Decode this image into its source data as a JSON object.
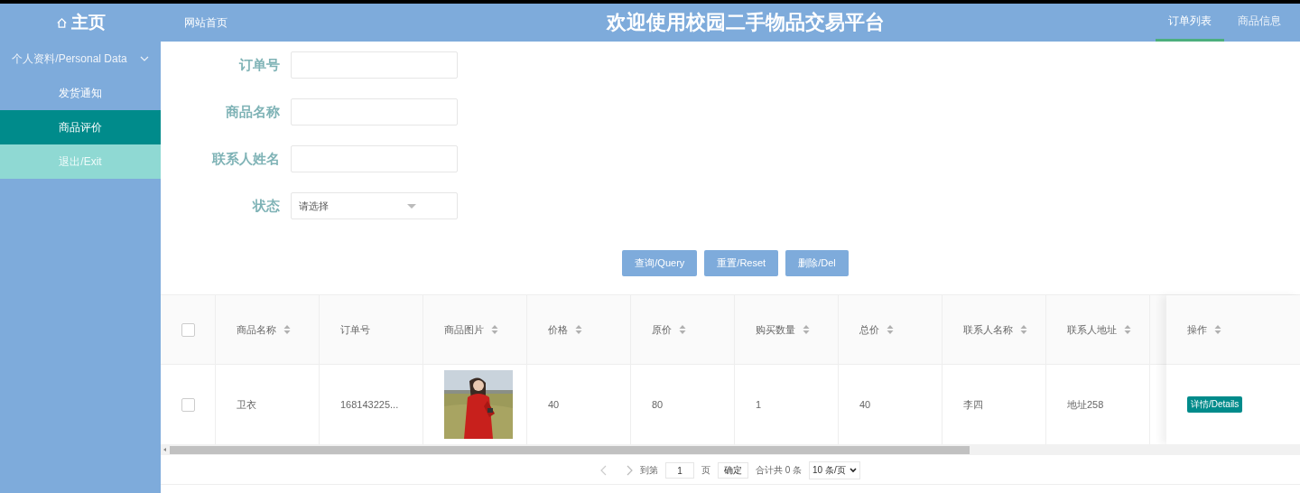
{
  "header": {
    "home": "主页",
    "site_link": "网站首页",
    "title": "欢迎使用校园二手物品交易平台",
    "nav": [
      {
        "label": "订单列表",
        "selected": true
      },
      {
        "label": "商品信息",
        "selected": false
      }
    ]
  },
  "sidebar": {
    "items": [
      {
        "label": "个人资料/Personal Data",
        "kind": "group",
        "expanded": true
      },
      {
        "label": "发货通知",
        "kind": "link",
        "selected": false
      },
      {
        "label": "商品评价",
        "kind": "link",
        "selected": true
      },
      {
        "label": "退出/Exit",
        "kind": "exit",
        "selected": false
      }
    ]
  },
  "search": {
    "fields": [
      {
        "label": "订单号",
        "kind": "text"
      },
      {
        "label": "商品名称",
        "kind": "text"
      },
      {
        "label": "联系人姓名",
        "kind": "text"
      },
      {
        "label": "状态",
        "kind": "select",
        "placeholder": "请选择"
      }
    ],
    "buttons": [
      "查询/Query",
      "重置/Reset",
      "删除/Del"
    ]
  },
  "table": {
    "select_all": {
      "checked": false
    },
    "columns": [
      {
        "label": "商品名称",
        "sortable": true
      },
      {
        "label": "订单号",
        "sortable": false
      },
      {
        "label": "商品图片",
        "sortable": true
      },
      {
        "label": "价格",
        "sortable": true
      },
      {
        "label": "原价",
        "sortable": true
      },
      {
        "label": "购买数量",
        "sortable": true
      },
      {
        "label": "总价",
        "sortable": true
      },
      {
        "label": "联系人名称",
        "sortable": true
      },
      {
        "label": "联系人地址",
        "sortable": true
      }
    ],
    "action_column": {
      "label": "操作",
      "sortable": true
    },
    "rows": [
      {
        "checked": false,
        "cells": [
          {
            "kind": "text",
            "text": "卫衣"
          },
          {
            "kind": "text",
            "text": "168143225..."
          },
          {
            "kind": "picture"
          },
          {
            "kind": "text",
            "text": "40"
          },
          {
            "kind": "text",
            "text": "80"
          },
          {
            "kind": "text",
            "text": "1"
          },
          {
            "kind": "text",
            "text": "40"
          },
          {
            "kind": "text",
            "text": "李四"
          },
          {
            "kind": "text",
            "text": "地址258"
          }
        ],
        "action": "详情/Details"
      }
    ]
  },
  "pagination": {
    "goto_label": "到第",
    "page": "1",
    "page_unit": "页",
    "confirm": "确定",
    "total": "合计共 0 条",
    "page_size": "10 条/页"
  }
}
